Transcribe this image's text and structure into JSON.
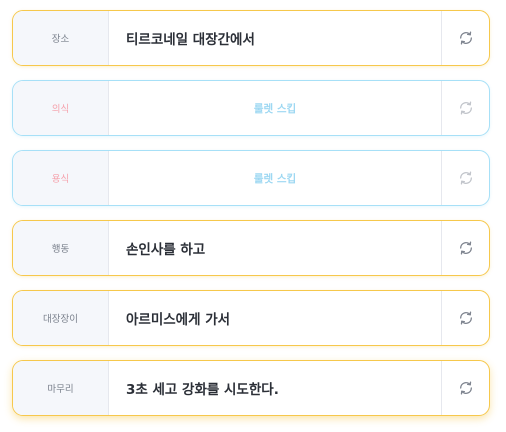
{
  "rows": [
    {
      "category": "장소",
      "value": "티르코네일 대장간에서",
      "state": "active",
      "button_icon": "refresh-icon"
    },
    {
      "category": "의식",
      "value": "룰렛 스킵",
      "state": "skipped",
      "button_icon": "refresh-icon"
    },
    {
      "category": "용식",
      "value": "룰렛 스킵",
      "state": "skipped",
      "button_icon": "refresh-icon"
    },
    {
      "category": "행동",
      "value": "손인사를 하고",
      "state": "active",
      "button_icon": "refresh-icon"
    },
    {
      "category": "대장장이",
      "value": "아르미스에게 가서",
      "state": "active",
      "button_icon": "refresh-icon"
    },
    {
      "category": "마무리",
      "value": "3초 세고 강화를 시도한다.",
      "state": "active",
      "button_icon": "refresh-icon"
    }
  ],
  "colors": {
    "active_border": "#f6c84c",
    "skipped_border": "#a7e0f7",
    "skipped_category_text": "#f5a3ad",
    "skipped_value_text": "#9ed8f2",
    "category_background": "#f5f7fb",
    "value_text": "#2b2f37"
  }
}
